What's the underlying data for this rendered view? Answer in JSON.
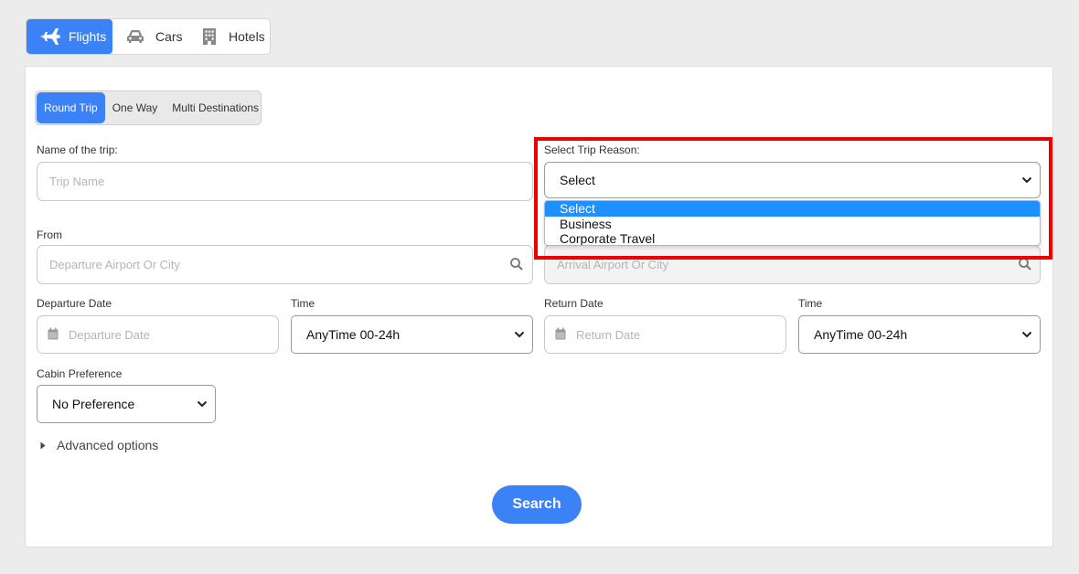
{
  "top_tabs": {
    "flights": "Flights",
    "cars": "Cars",
    "hotels": "Hotels"
  },
  "trip_type": {
    "round_trip": "Round Trip",
    "one_way": "One Way",
    "multi": "Multi Destinations"
  },
  "trip_name": {
    "label": "Name of the trip:",
    "placeholder": "Trip Name"
  },
  "trip_reason": {
    "label": "Select Trip Reason:",
    "value": "Select",
    "options": [
      "Select",
      "Business",
      "Corporate Travel"
    ]
  },
  "from": {
    "label": "From",
    "placeholder": "Departure Airport Or City"
  },
  "to": {
    "placeholder": "Arrival Airport Or City"
  },
  "departure_date": {
    "label": "Departure Date",
    "placeholder": "Departure Date"
  },
  "departure_time": {
    "label": "Time",
    "value": "AnyTime 00-24h"
  },
  "return_date": {
    "label": "Return Date",
    "placeholder": "Return Date"
  },
  "return_time": {
    "label": "Time",
    "value": "AnyTime 00-24h"
  },
  "cabin": {
    "label": "Cabin Preference",
    "value": "No Preference"
  },
  "advanced_options": "Advanced options",
  "search_button": "Search",
  "colors": {
    "accent": "#3b82f6",
    "highlight": "#ee0000",
    "option_selected": "#1e90ff"
  },
  "icons": {
    "flights": "airplane-icon",
    "cars": "car-icon",
    "hotels": "building-icon",
    "search": "magnifier-icon",
    "calendar": "calendar-icon",
    "dropdown": "chevron-down-icon",
    "advanced": "caret-right-icon"
  }
}
